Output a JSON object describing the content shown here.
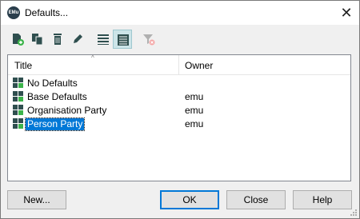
{
  "window": {
    "title": "Defaults...",
    "app_icon_text": "EMu"
  },
  "toolbar": {
    "items": [
      {
        "name": "new-record-icon"
      },
      {
        "name": "copy-icon"
      },
      {
        "name": "delete-icon"
      },
      {
        "name": "edit-icon"
      },
      {
        "name": "list-view-icon"
      },
      {
        "name": "details-view-icon",
        "active": true
      },
      {
        "name": "clear-filter-icon",
        "disabled": true
      }
    ]
  },
  "list": {
    "columns": {
      "title": "Title",
      "owner": "Owner",
      "sort_indicator": "^"
    },
    "rows": [
      {
        "title": "No Defaults",
        "owner": ""
      },
      {
        "title": "Base Defaults",
        "owner": "emu"
      },
      {
        "title": "Organisation Party",
        "owner": "emu"
      },
      {
        "title": "Person Party",
        "owner": "emu",
        "selected": true
      }
    ]
  },
  "buttons": {
    "new": "New...",
    "ok": "OK",
    "close": "Close",
    "help": "Help"
  },
  "colors": {
    "accent": "#0078d7",
    "icon_dark": "#2f4f4f",
    "icon_green": "#3cb44b"
  }
}
